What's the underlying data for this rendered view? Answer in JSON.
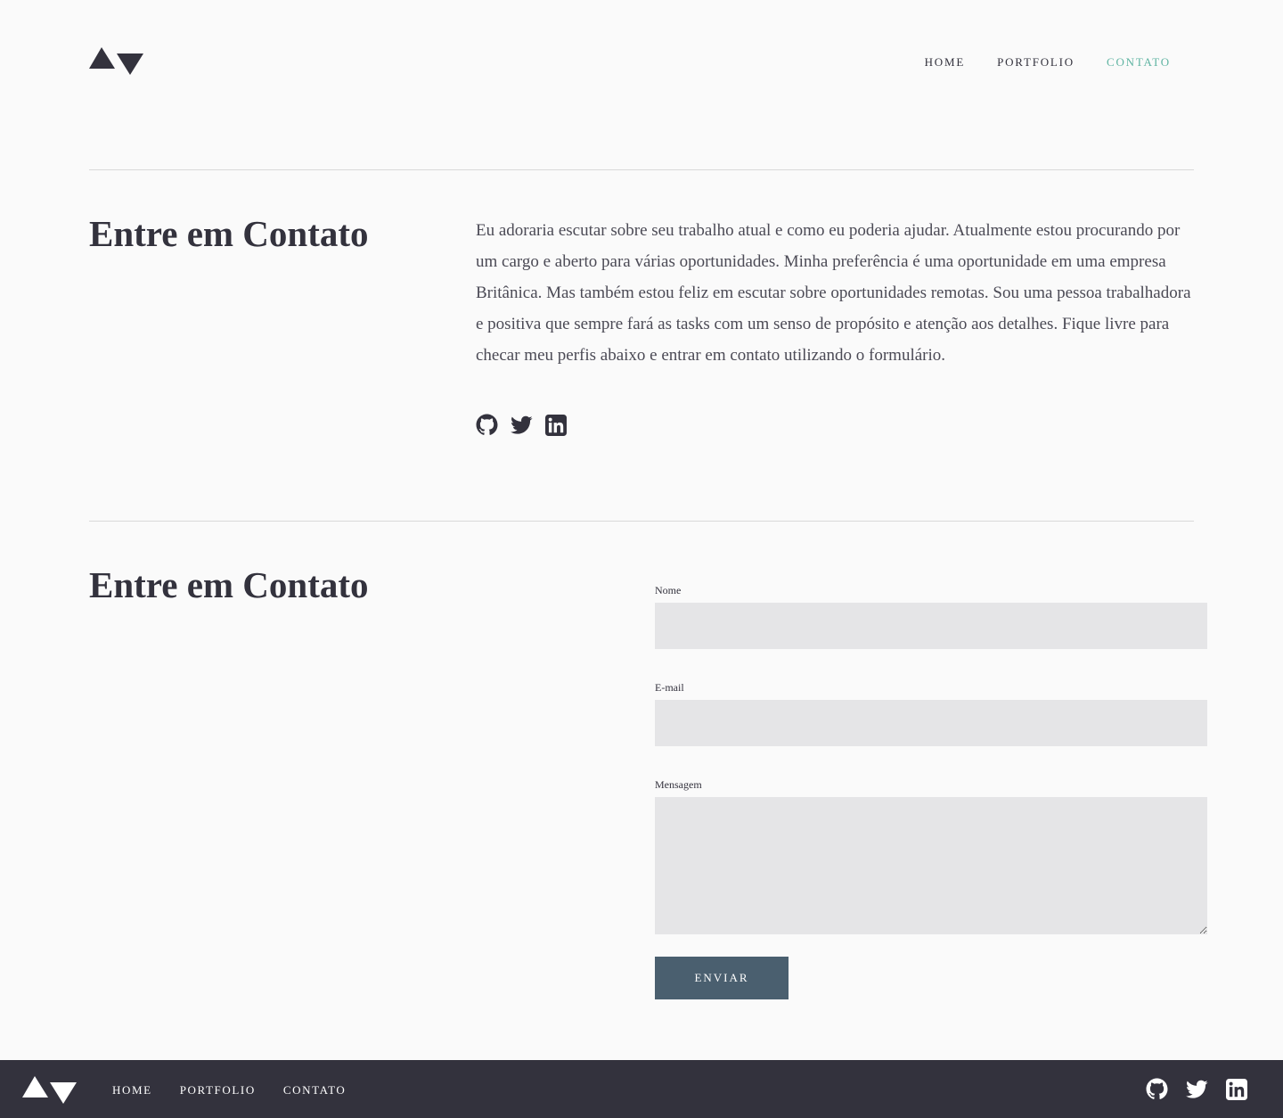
{
  "header": {
    "nav": [
      {
        "label": "HOME",
        "active": false
      },
      {
        "label": "PORTFOLIO",
        "active": false
      },
      {
        "label": "CONTATO",
        "active": true
      }
    ]
  },
  "intro": {
    "title": "Entre em Contato",
    "text": "Eu adoraria escutar sobre seu trabalho atual e como eu poderia ajudar. Atualmente estou procurando por um cargo e aberto para várias oportunidades. Minha preferência é uma oportunidade em uma empresa Britânica. Mas também estou feliz em escutar sobre oportunidades remotas. Sou uma pessoa trabalhadora e positiva que sempre fará as tasks com um senso de propósito e atenção aos detalhes. Fique livre para checar meu perfis abaixo e entrar em contato utilizando o formulário.",
    "social_icons": [
      "github-icon",
      "twitter-icon",
      "linkedin-icon"
    ]
  },
  "contact_form": {
    "title": "Entre em Contato",
    "name_label": "Nome",
    "name_value": "",
    "email_label": "E-mail",
    "email_value": "",
    "message_label": "Mensagem",
    "message_value": "",
    "submit_label": "ENVIAR"
  },
  "footer": {
    "nav": [
      {
        "label": "HOME"
      },
      {
        "label": "PORTFOLIO"
      },
      {
        "label": "CONTATO"
      }
    ],
    "social_icons": [
      "github-icon",
      "twitter-icon",
      "linkedin-icon"
    ]
  },
  "colors": {
    "background": "#fafafa",
    "text": "#33323d",
    "accent": "#5fb4a2",
    "button": "#4a5f6f",
    "input_bg": "#e5e5e7",
    "footer_bg": "#33323d"
  }
}
